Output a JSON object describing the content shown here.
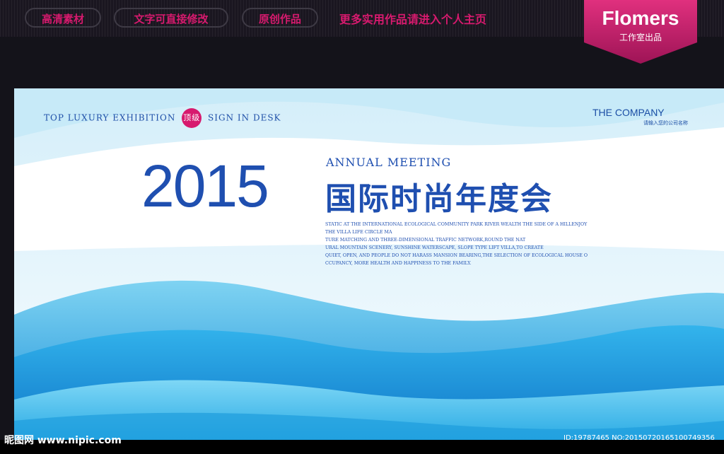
{
  "header": {
    "pills": [
      "高清素材",
      "文字可直接修改",
      "原创作品"
    ],
    "promo": "更多实用作品请进入个人主页",
    "badge_title": "Flomers",
    "badge_sub": "工作室出品"
  },
  "board": {
    "tagline": {
      "part1": "TOP LUXURY EXHIBITION",
      "badge": "顶级",
      "part2": "SIGN IN DESK"
    },
    "company": "THE COMPANY",
    "company_sub": "请输入您的公司名称",
    "year": "2015",
    "annual": "ANNUAL MEETING",
    "title_cn": "国际时尚年度会",
    "body_lines": [
      "STATIC AT THE INTERNATIONAL ECOLOGICAL COMMUNITY PARK RIVER WEALTH THE SIDE OF A HILLENJOY",
      "THE VILLA LIFE CIRCLE MA",
      "TURE MATCHING AND THREE-DIMENSIONAL TRAFFIC NETWORK,ROUND THE NAT",
      "URAL MOUNTAIN SCENERY, SUNSHINE WATERSCAPE, SLOPE TYPE LIFT VILLA,TO CREATE",
      "QUIET, OPEN, AND PEOPLE DO NOT HARASS MANSION BEARING,THE SELECTION OF ECOLOGICAL HOUSE O",
      "CCUPANCY, MORE HEALTH AND HAPPINESS TO THE FAMILY."
    ]
  },
  "footer": {
    "logo": "昵图网 www.nipic.com",
    "id": "ID:19787465 NO:20150720165100749356"
  },
  "colors": {
    "accent": "#d71a6e",
    "title_blue": "#1f4fb0",
    "background": "#14131a"
  }
}
